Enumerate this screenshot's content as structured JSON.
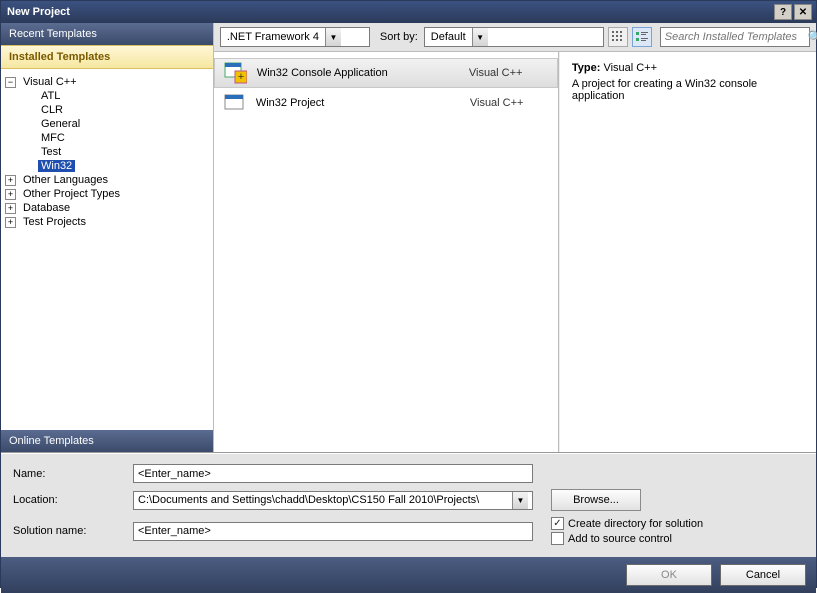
{
  "window": {
    "title": "New Project"
  },
  "sidebar": {
    "recent": "Recent Templates",
    "installed": "Installed Templates",
    "online": "Online Templates",
    "tree": {
      "root": "Visual C++",
      "children": [
        "ATL",
        "CLR",
        "General",
        "MFC",
        "Test",
        "Win32"
      ],
      "selectedIndex": 5,
      "siblings": [
        "Other Languages",
        "Other Project Types",
        "Database",
        "Test Projects"
      ]
    }
  },
  "toolbar": {
    "framework": ".NET Framework 4",
    "sortby_label": "Sort by:",
    "sortby_value": "Default",
    "search_placeholder": "Search Installed Templates"
  },
  "projects": [
    {
      "name": "Win32 Console Application",
      "lang": "Visual C++",
      "selected": true
    },
    {
      "name": "Win32 Project",
      "lang": "Visual C++",
      "selected": false
    }
  ],
  "details": {
    "type_label": "Type:",
    "type_value": "Visual C++",
    "description": "A project for creating a Win32 console application"
  },
  "form": {
    "name_label": "Name:",
    "name_value": "<Enter_name>",
    "location_label": "Location:",
    "location_value": "C:\\Documents and Settings\\chadd\\Desktop\\CS150 Fall 2010\\Projects\\",
    "solution_label": "Solution name:",
    "solution_value": "<Enter_name>",
    "browse": "Browse...",
    "create_dir": "Create directory for solution",
    "add_source": "Add to source control"
  },
  "footer": {
    "ok": "OK",
    "cancel": "Cancel"
  }
}
